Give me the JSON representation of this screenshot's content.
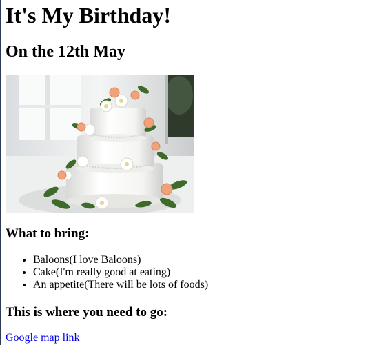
{
  "page": {
    "title": "It's My Birthday!",
    "date_heading": "On the 12th May"
  },
  "image": {
    "subject": "cake-image"
  },
  "bring": {
    "heading": "What to bring:",
    "items": [
      "Baloons(I love Baloons)",
      "Cake(I'm really good at eating)",
      "An appetite(There will be lots of foods)"
    ]
  },
  "directions": {
    "heading": "This is where you need to go:",
    "link_text": "Google map link"
  },
  "colors": {
    "link": "#0000ee",
    "text": "#000000",
    "left_border": "#2b3a55"
  }
}
